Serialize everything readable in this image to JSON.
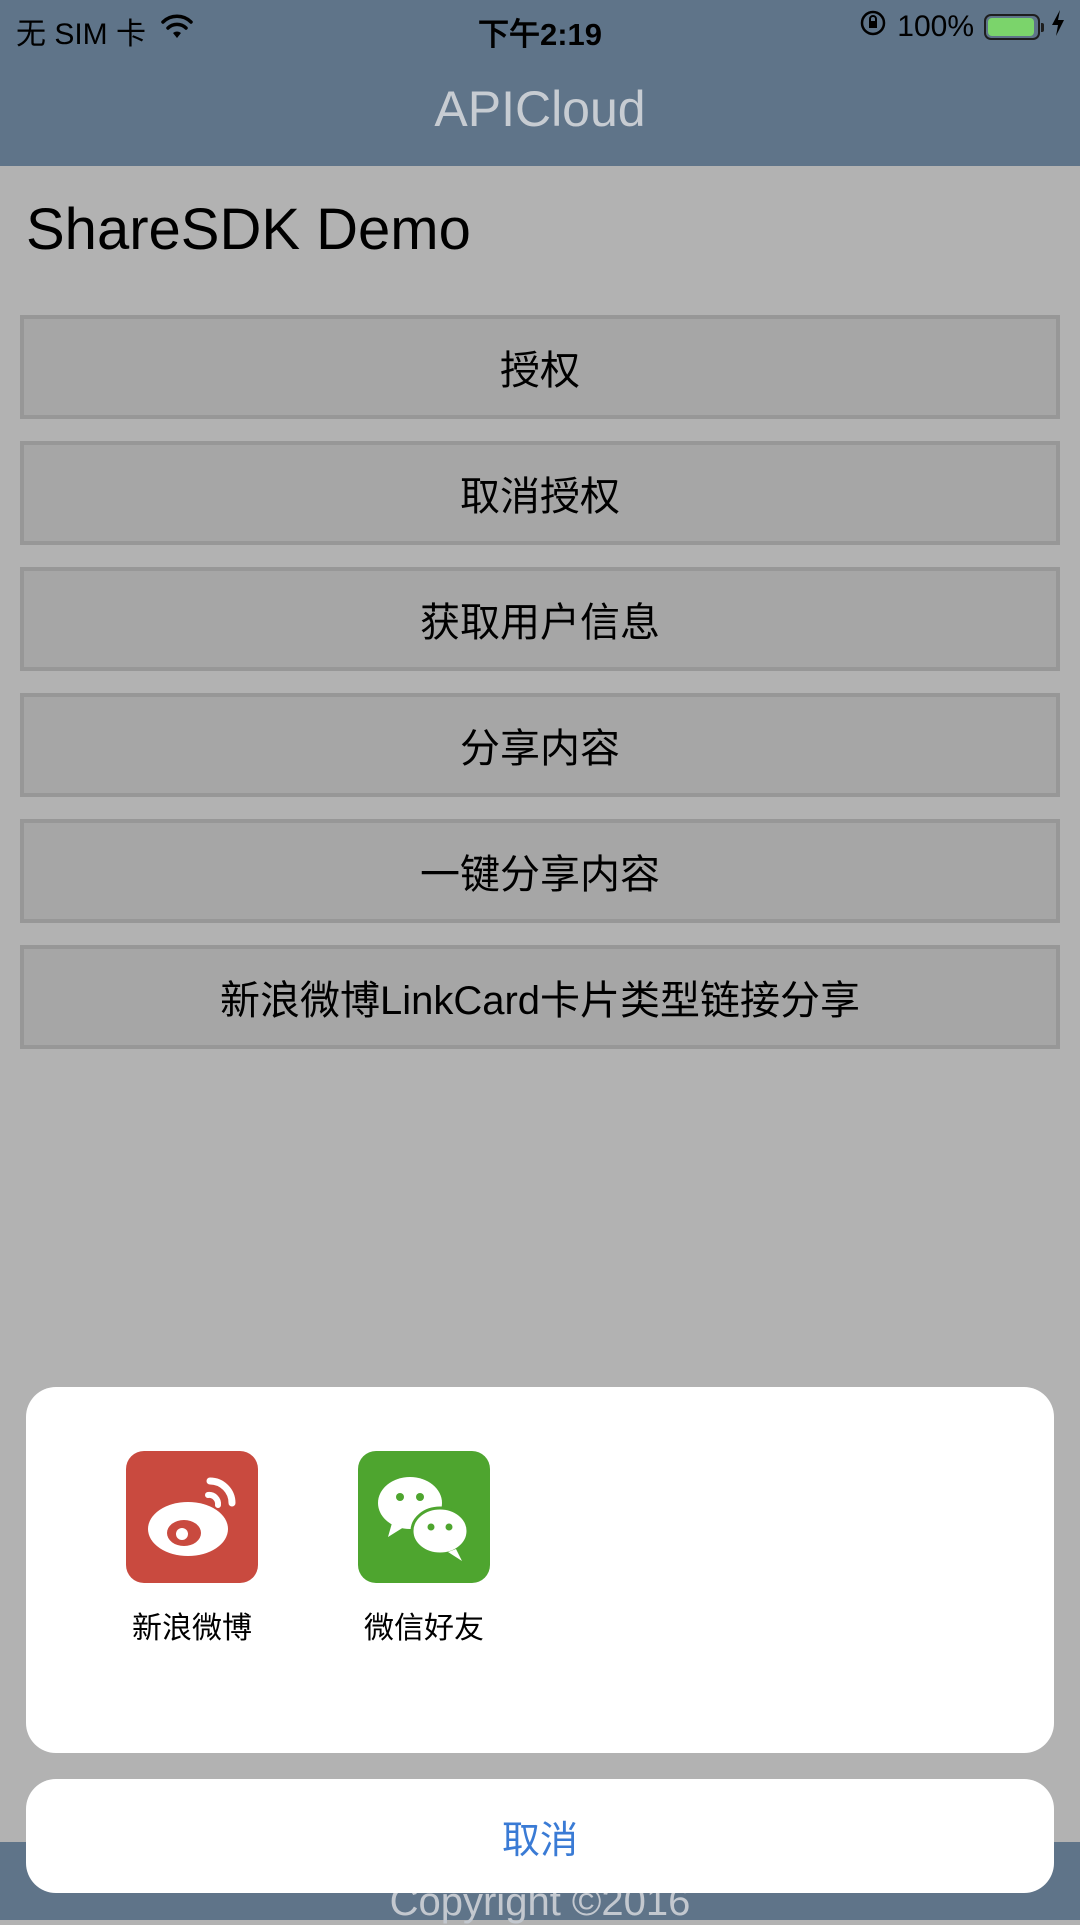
{
  "status_bar": {
    "carrier": "无 SIM 卡",
    "time": "下午2:19",
    "battery_percent": "100%"
  },
  "header": {
    "title": "APICloud"
  },
  "page": {
    "heading": "ShareSDK Demo"
  },
  "actions": [
    {
      "label": "授权"
    },
    {
      "label": "取消授权"
    },
    {
      "label": "获取用户信息"
    },
    {
      "label": "分享内容"
    },
    {
      "label": "一键分享内容"
    },
    {
      "label": "新浪微博LinkCard卡片类型链接分享"
    }
  ],
  "share_sheet": {
    "items": [
      {
        "label": "新浪微博",
        "icon": "weibo-icon",
        "color": "#c94a3f"
      },
      {
        "label": "微信好友",
        "icon": "wechat-icon",
        "color": "#4ea52f"
      }
    ],
    "cancel_label": "取消"
  },
  "footer": {
    "text": "Copyright ©2016"
  },
  "colors": {
    "header": "#5f7489",
    "overlay": "#b2b2b2",
    "cancel_text": "#3a7bd5"
  }
}
